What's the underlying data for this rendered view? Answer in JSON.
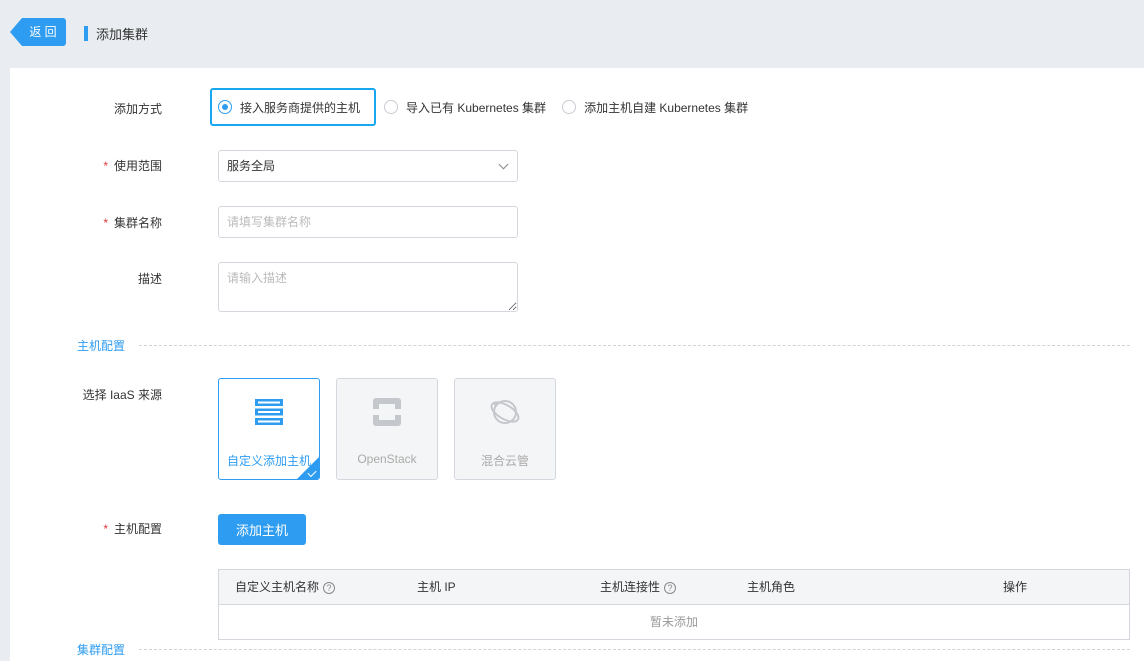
{
  "header": {
    "back_label": "返 回",
    "title": "添加集群"
  },
  "form": {
    "method_label": "添加方式",
    "method_options": [
      {
        "label": "接入服务商提供的主机",
        "selected": true
      },
      {
        "label": "导入已有 Kubernetes 集群",
        "selected": false
      },
      {
        "label": "添加主机自建 Kubernetes 集群",
        "selected": false
      }
    ],
    "scope_label": "使用范围",
    "scope_value": "服务全局",
    "name_label": "集群名称",
    "name_placeholder": "请填写集群名称",
    "desc_label": "描述",
    "desc_placeholder": "请输入描述"
  },
  "host_section": {
    "title": "主机配置",
    "iaas_label": "选择 IaaS 来源",
    "iaas_options": [
      {
        "label": "自定义添加主机",
        "icon": "server-icon",
        "active": true
      },
      {
        "label": "OpenStack",
        "icon": "openstack-icon",
        "active": false
      },
      {
        "label": "混合云管",
        "icon": "hybrid-cloud-icon",
        "active": false
      }
    ],
    "host_config_label": "主机配置",
    "add_host_button": "添加主机",
    "table": {
      "columns": [
        "自定义主机名称",
        "主机 IP",
        "主机连接性",
        "主机角色",
        "操作"
      ],
      "help_glyph": "?",
      "empty_text": "暂未添加"
    }
  },
  "cluster_section": {
    "title": "集群配置"
  },
  "colors": {
    "accent": "#2e9cf0",
    "required": "#e4393c",
    "highlight_border": "#19a7f0"
  }
}
